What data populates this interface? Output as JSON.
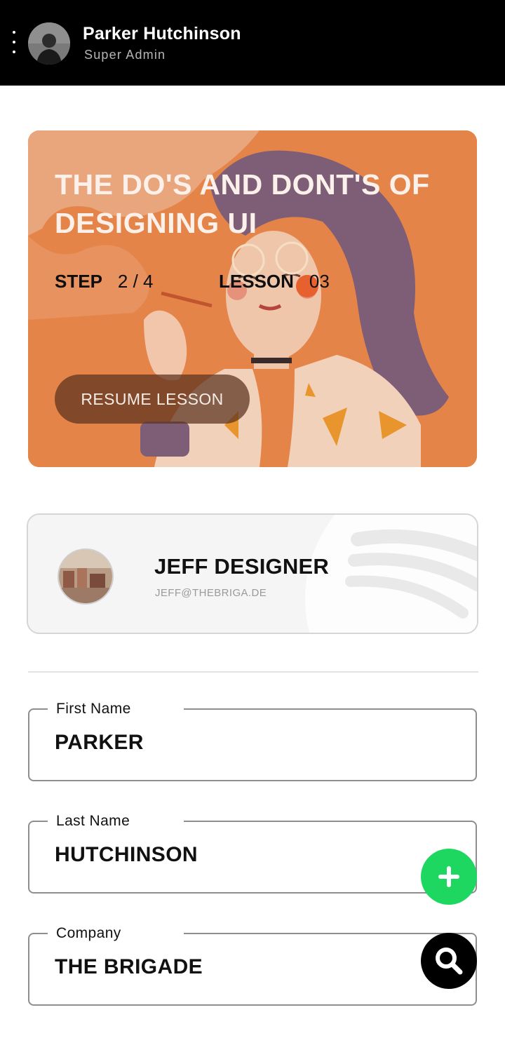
{
  "header": {
    "user_name": "Parker Hutchinson",
    "user_role": "Super Admin",
    "menu_icon": "vertical-dots-icon",
    "background": "#000000"
  },
  "lesson": {
    "title": "THE DO'S AND DONT'S OF DESIGNING UI",
    "step_label": "STEP",
    "step_value": "2 / 4",
    "lesson_label": "LESSON",
    "lesson_value": "03",
    "resume_label": "RESUME LESSON",
    "accent": "#e58449"
  },
  "contact": {
    "name": "JEFF DESIGNER",
    "email": "JEFF@THEBRIGA.DE"
  },
  "form": {
    "first_name": {
      "label": "First Name",
      "value": "PARKER"
    },
    "last_name": {
      "label": "Last Name",
      "value": "HUTCHINSON"
    },
    "company": {
      "label": "Company",
      "value": "THE BRIGADE"
    }
  },
  "fabs": {
    "add_icon": "plus-icon",
    "add_color": "#1ed760",
    "search_icon": "search-icon",
    "search_color": "#000000"
  }
}
